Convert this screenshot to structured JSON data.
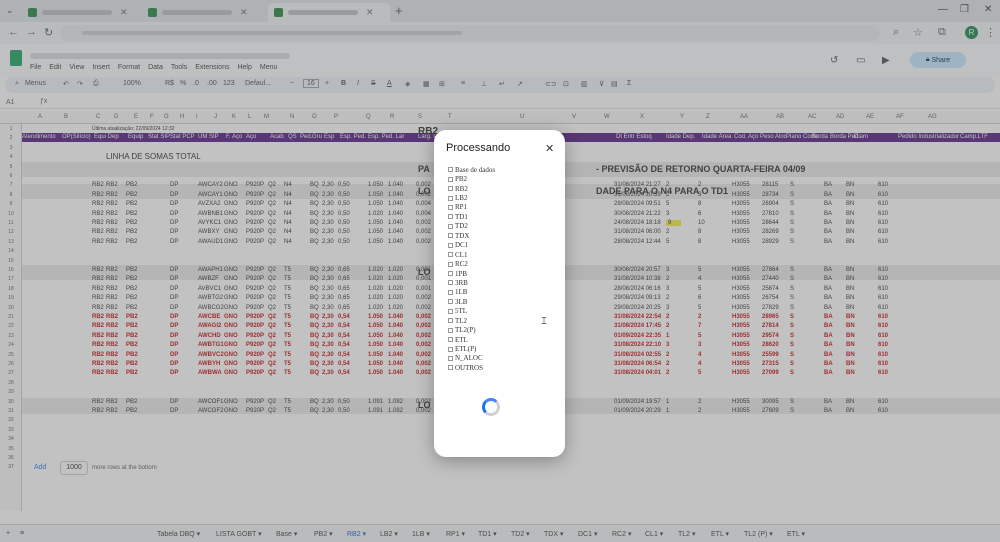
{
  "browser": {
    "tabs": [
      {
        "id": "t1",
        "active": false
      },
      {
        "id": "t2",
        "active": false
      },
      {
        "id": "t3",
        "active": true
      }
    ],
    "new_tab": "+",
    "profile_initial": "R"
  },
  "sheets": {
    "menu": [
      "File",
      "Edit",
      "View",
      "Insert",
      "Format",
      "Data",
      "Tools",
      "Extensions",
      "Help",
      "Menu"
    ],
    "share_label": "Share",
    "toolbar": {
      "menus": "Menus",
      "zoom": "100%",
      "currency": "R$",
      "percent": "%",
      "dec1": ".0",
      "dec2": ".00",
      "numfmt": "123",
      "font": "Defaul...",
      "size": "16"
    },
    "name_box": "A1",
    "col_letters": [
      "A",
      "B",
      "C",
      "D",
      "E",
      "F",
      "G",
      "H",
      "I",
      "J",
      "K",
      "L",
      "M",
      "N",
      "O",
      "P",
      "Q",
      "R",
      "S",
      "T",
      "U",
      "V",
      "W",
      "X",
      "Y",
      "Z",
      "AA",
      "AB",
      "AC",
      "AD",
      "AE",
      "AF",
      "AG"
    ],
    "last_update": "Última atualização: 22/09/2024 12:32",
    "rb2_title": "RB2",
    "header_row": [
      "Atendimento",
      "OP(Silício)",
      "Equi Dep",
      "Equip",
      "Stat SIP",
      "Stat PCP",
      "UM SIP",
      "F. Aço",
      "Aço",
      "Acab",
      "QS",
      "Ped.",
      "Gru",
      "Esp",
      "Esp. Ped.",
      "Esp. Ped. Lar",
      "Larg. Ped.",
      "Toor Ct",
      "ente",
      "Dt Entr Estoq",
      "Idade Dep.",
      "Idade Área",
      "Cod. Aço",
      "Peso Aloc",
      "Plano Corte",
      "Borda",
      "Borda Ped.",
      "Diam",
      "Pedido Industrializador",
      "Camp.LTF"
    ],
    "linha_somas": "LINHA DE SOMAS TOTAL",
    "banner_pa": "PA",
    "banner_retorno": "- PREVISÃO DE RETORNO QUARTA-FEIRA 04/09",
    "banner_lo1": "LO",
    "banner_n4": "DADE PARA O N4 PARA O TD1",
    "banner_lo2": "LO",
    "banner_lo3": "LO",
    "add_label": "Add",
    "rows_count": "1000",
    "rows_suffix": "more rows at the bottom",
    "rows": [
      {
        "n": "7",
        "red": false,
        "c": [
          "RB2",
          "RB2",
          "PB2",
          "DP",
          "AWCAY2",
          "GNO",
          "P920P",
          "Q2",
          "N4",
          "BQ",
          "2,30",
          "0,50",
          "1.050",
          "1.040",
          "0,002",
          "31/08/2024 21:27",
          "2",
          "2",
          "H3055",
          "28115",
          "S",
          "BA",
          "BN",
          "610"
        ]
      },
      {
        "n": "8",
        "red": false,
        "c": [
          "RB2",
          "RB2",
          "PB2",
          "DP",
          "AWCAY1",
          "GNO",
          "P920P",
          "Q2",
          "N4",
          "BQ",
          "2,30",
          "0,50",
          "1.050",
          "1.040",
          "0,002",
          "31/08/2024 20:39",
          "2",
          "3",
          "H3055",
          "28734",
          "S",
          "BA",
          "BN",
          "610"
        ]
      },
      {
        "n": "9",
        "red": false,
        "c": [
          "RB2",
          "RB2",
          "PB2",
          "DP",
          "AVZXA2",
          "GNO",
          "P920P",
          "Q2",
          "N4",
          "BQ",
          "2,30",
          "0,50",
          "1.050",
          "1.040",
          "0,004",
          "28/08/2024 09:51",
          "5",
          "8",
          "H3055",
          "26904",
          "S",
          "BA",
          "BN",
          "610"
        ]
      },
      {
        "n": "10",
        "red": false,
        "c": [
          "RB2",
          "RB2",
          "PB2",
          "DP",
          "AWBNB1",
          "GNO",
          "P920P",
          "Q2",
          "N4",
          "BQ",
          "2,30",
          "0,50",
          "1.020",
          "1.040",
          "0,004",
          "30/08/2024 21:22",
          "3",
          "6",
          "H3055",
          "27810",
          "S",
          "BA",
          "BN",
          "610"
        ]
      },
      {
        "n": "11",
        "red": false,
        "c": [
          "RB2",
          "RB2",
          "PB2",
          "DP",
          "AVYKC1",
          "GNO",
          "P920P",
          "Q2",
          "N4",
          "BQ",
          "2,30",
          "0,50",
          "1.050",
          "1.040",
          "0,002",
          "24/08/2024 18:18",
          "9",
          "10",
          "H3055",
          "28644",
          "S",
          "BA",
          "BN",
          "610"
        ]
      },
      {
        "n": "12",
        "red": false,
        "c": [
          "RB2",
          "RB2",
          "PB2",
          "DP",
          "AWBXY",
          "GNO",
          "P920P",
          "Q2",
          "N4",
          "BQ",
          "2,30",
          "0,50",
          "1.050",
          "1.040",
          "0,002",
          "31/08/2024 06:00",
          "2",
          "8",
          "H3055",
          "28269",
          "S",
          "BA",
          "BN",
          "610"
        ]
      },
      {
        "n": "13",
        "red": false,
        "c": [
          "RB2",
          "RB2",
          "PB2",
          "DP",
          "AWAUD1",
          "GNO",
          "P920P",
          "Q2",
          "N4",
          "BQ",
          "2,30",
          "0,50",
          "1.050",
          "1.040",
          "0,002",
          "28/08/2024 12:44",
          "5",
          "8",
          "H3055",
          "28929",
          "S",
          "BA",
          "BN",
          "610"
        ]
      },
      {
        "n": "16",
        "red": false,
        "c": [
          "RB2",
          "RB2",
          "PB2",
          "DP",
          "AWAPH1",
          "GNO",
          "P920P",
          "Q2",
          "T5",
          "BQ",
          "2,30",
          "0,65",
          "1.020",
          "1.020",
          "0,001",
          "30/08/2024 20:57",
          "3",
          "5",
          "H3055",
          "27864",
          "S",
          "BA",
          "BN",
          "610"
        ]
      },
      {
        "n": "17",
        "red": false,
        "c": [
          "RB2",
          "RB2",
          "PB2",
          "DP",
          "AWBZF",
          "GNO",
          "P920P",
          "Q2",
          "T5",
          "BQ",
          "2,30",
          "0,65",
          "1.020",
          "1.020",
          "0,001",
          "31/08/2024 10:38",
          "2",
          "4",
          "H3055",
          "27440",
          "S",
          "BA",
          "BN",
          "610"
        ]
      },
      {
        "n": "18",
        "red": false,
        "c": [
          "RB2",
          "RB2",
          "PB2",
          "DP",
          "AVBVC1",
          "GNO",
          "P920P",
          "Q2",
          "T5",
          "BQ",
          "2,30",
          "0,65",
          "1.020",
          "1.020",
          "0,001",
          "28/08/2024 06:16",
          "3",
          "5",
          "H3055",
          "25874",
          "S",
          "BA",
          "BN",
          "610"
        ]
      },
      {
        "n": "19",
        "red": false,
        "c": [
          "RB2",
          "RB2",
          "PB2",
          "DP",
          "AWBTG2",
          "GNO",
          "P920P",
          "Q2",
          "T5",
          "BQ",
          "2,30",
          "0,65",
          "1.020",
          "1.020",
          "0,002",
          "29/08/2024 09:13",
          "2",
          "6",
          "H3055",
          "26754",
          "S",
          "BA",
          "BN",
          "610"
        ]
      },
      {
        "n": "20",
        "red": false,
        "c": [
          "RB2",
          "RB2",
          "PB2",
          "DP",
          "AWBCG2",
          "GNO",
          "P920P",
          "Q2",
          "T5",
          "BQ",
          "2,30",
          "0,65",
          "1.020",
          "1.020",
          "0,002",
          "29/08/2024 20:25",
          "3",
          "5",
          "H3055",
          "27829",
          "S",
          "BA",
          "BN",
          "610"
        ]
      },
      {
        "n": "21",
        "red": true,
        "c": [
          "RB2",
          "RB2",
          "PB2",
          "DP",
          "AWCBE",
          "GNO",
          "P920P",
          "Q2",
          "T5",
          "BQ",
          "2,30",
          "0,54",
          "1.050",
          "1.040",
          "0,002",
          "31/08/2024 22:54",
          "2",
          "2",
          "H3055",
          "28965",
          "S",
          "BA",
          "BN",
          "610"
        ]
      },
      {
        "n": "22",
        "red": true,
        "c": [
          "RB2",
          "RB2",
          "PB2",
          "DP",
          "AWAGI2",
          "GNO",
          "P920P",
          "Q2",
          "T5",
          "BQ",
          "2,30",
          "0,54",
          "1.050",
          "1.040",
          "0,002",
          "31/08/2024 17:45",
          "2",
          "7",
          "H3055",
          "27814",
          "S",
          "BA",
          "BN",
          "610"
        ]
      },
      {
        "n": "23",
        "red": true,
        "c": [
          "RB2",
          "RB2",
          "PB2",
          "DP",
          "AWCHD",
          "GNO",
          "P920P",
          "Q2",
          "T5",
          "BQ",
          "2,30",
          "0,54",
          "1.050",
          "1.040",
          "0,002",
          "01/09/2024 22:35",
          "1",
          "5",
          "H3055",
          "29574",
          "S",
          "BA",
          "BN",
          "610"
        ]
      },
      {
        "n": "24",
        "red": true,
        "c": [
          "RB2",
          "RB2",
          "PB2",
          "DP",
          "AWBTG1",
          "GNO",
          "P920P",
          "Q2",
          "T5",
          "BQ",
          "2,30",
          "0,54",
          "1.050",
          "1.040",
          "0,002",
          "31/08/2024 22:10",
          "3",
          "3",
          "H3055",
          "28620",
          "S",
          "BA",
          "BN",
          "610"
        ]
      },
      {
        "n": "25",
        "red": true,
        "c": [
          "RB2",
          "RB2",
          "PB2",
          "DP",
          "AWBVC2",
          "GNO",
          "P920P",
          "Q2",
          "T5",
          "BQ",
          "2,30",
          "0,54",
          "1.050",
          "1.040",
          "0,002",
          "31/08/2024 02:55",
          "2",
          "4",
          "H3055",
          "25599",
          "S",
          "BA",
          "BN",
          "610"
        ]
      },
      {
        "n": "26",
        "red": true,
        "c": [
          "RB2",
          "RB2",
          "PB2",
          "DP",
          "AWBYH",
          "GNO",
          "P920P",
          "Q2",
          "T5",
          "BQ",
          "2,30",
          "0,54",
          "1.050",
          "1.040",
          "0,002",
          "31/08/2024 06:54",
          "2",
          "4",
          "H3055",
          "27315",
          "S",
          "BA",
          "BN",
          "610"
        ]
      },
      {
        "n": "27",
        "red": true,
        "c": [
          "RB2",
          "RB2",
          "PB2",
          "DP",
          "AWBWA",
          "GNO",
          "P920P",
          "Q2",
          "T5",
          "BQ",
          "2,30",
          "0,54",
          "1.050",
          "1.040",
          "0,002",
          "31/08/2024 04:01",
          "2",
          "5",
          "H3055",
          "27099",
          "S",
          "BA",
          "BN",
          "610"
        ]
      },
      {
        "n": "30",
        "red": false,
        "c": [
          "RB2",
          "RB2",
          "PB2",
          "DP",
          "AWCOF1",
          "GNO",
          "P920P",
          "Q2",
          "T5",
          "BQ",
          "2,30",
          "0,50",
          "1.091",
          "1.082",
          "0,002",
          "01/09/2024 19:57",
          "1",
          "2",
          "H3055",
          "30095",
          "S",
          "BA",
          "BN",
          "610"
        ]
      },
      {
        "n": "31",
        "red": false,
        "c": [
          "RB2",
          "RB2",
          "PB2",
          "DP",
          "AWCGF2",
          "GNO",
          "P920P",
          "Q2",
          "T5",
          "BQ",
          "2,30",
          "0,50",
          "1.091",
          "1.082",
          "0,002",
          "01/09/2024 20:29",
          "1",
          "2",
          "H3055",
          "27609",
          "S",
          "BA",
          "BN",
          "610"
        ]
      }
    ],
    "sheet_tabs": [
      "Tabela DBQ",
      "LISTA GOBT",
      "Base",
      "PB2",
      "RB2",
      "LB2",
      "1LB",
      "RP1",
      "TD1",
      "TD2",
      "TDX",
      "DC1",
      "RC2",
      "CL1",
      "TL2",
      "ETL",
      "TL2 (P)",
      "ETL"
    ],
    "active_sheet": "RB2"
  },
  "modal": {
    "title": "Processando",
    "close": "✕",
    "items": [
      "Base de dados",
      "PB2",
      "RB2",
      "LB2",
      "RP1",
      "TD1",
      "TD2",
      "TDX",
      "DC1",
      "CL1",
      "RC2",
      "1PB",
      "3RB",
      "1LB",
      "3LB",
      "5TL",
      "TL2",
      "TL2(P)",
      "ETL",
      "ETL(P)",
      "N_ALOC",
      "OUTROS"
    ]
  }
}
